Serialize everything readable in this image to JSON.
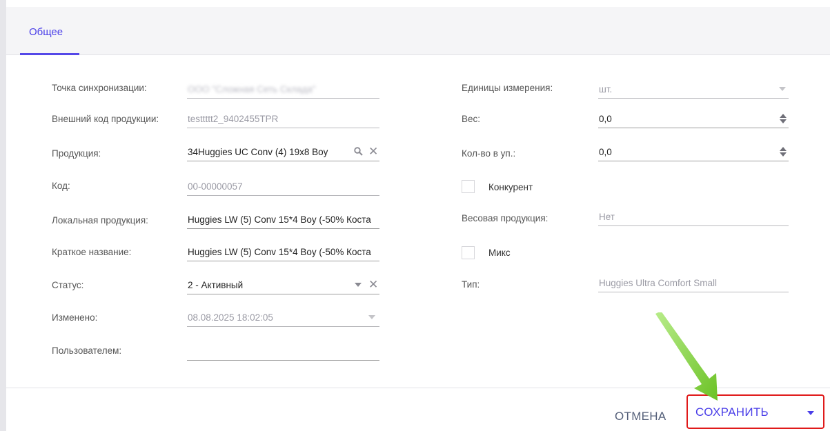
{
  "tabs": [
    {
      "label": "Общее"
    }
  ],
  "left_fields": [
    {
      "label": "Точка синхронизации:",
      "value": "ООО \"Сложная Сеть Склада\""
    },
    {
      "label": "Внешний код продукции:",
      "value": "testtttt2_9402455TPR"
    },
    {
      "label": "Продукция:",
      "value": "34Huggies UC Conv (4) 19x8 Boy"
    },
    {
      "label": "Код:",
      "value": "00-00000057"
    },
    {
      "label": "Локальная продукция:",
      "value": "Huggies  LW (5) Conv 15*4 Boy (-50% Коста"
    },
    {
      "label": "Краткое название:",
      "value": "Huggies  LW (5) Conv 15*4 Boy (-50% Коста"
    },
    {
      "label": "Статус:",
      "value": "2 - Активный"
    },
    {
      "label": "Изменено:",
      "value": "08.08.2025 18:02:05"
    },
    {
      "label": "Пользователем:",
      "value": ""
    }
  ],
  "right_fields": {
    "units": {
      "label": "Единицы измерения:",
      "value": "шт."
    },
    "weight": {
      "label": "Вес:",
      "value": "0,0"
    },
    "qty_pack": {
      "label": "Кол-во в уп.:",
      "value": "0,0"
    },
    "competitor": {
      "label": "Конкурент"
    },
    "weight_product": {
      "label": "Весовая продукция:",
      "value": "Нет"
    },
    "mix": {
      "label": "Микс"
    },
    "type": {
      "label": "Тип:",
      "value": "Huggies Ultra Comfort Small"
    }
  },
  "footer": {
    "cancel_label": "ОТМЕНА",
    "save_label": "СОХРАНИТЬ"
  },
  "icons": {
    "search": "search-icon",
    "clear": "close-icon",
    "dropdown": "caret-down-icon",
    "spinner": "spinner-icon"
  },
  "colors": {
    "accent": "#4a3ee8",
    "highlight_box": "#e01a1a",
    "arrow": "#7fd13b"
  }
}
